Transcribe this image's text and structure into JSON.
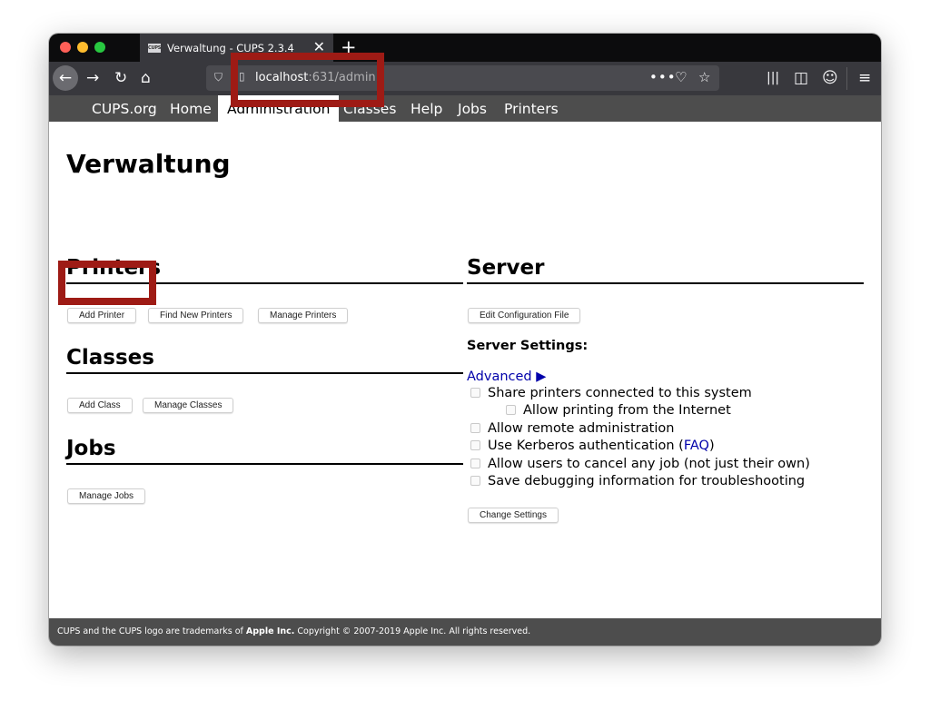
{
  "browser": {
    "tab": {
      "favicon_text": "CUPS",
      "title": "Verwaltung - CUPS 2.3.4",
      "close": "✕"
    },
    "new_tab": "+",
    "url": {
      "host": "localhost",
      "path": ":631/admin"
    },
    "icons": [
      "back-icon",
      "forward-icon",
      "reload-icon",
      "home-icon",
      "shield-icon",
      "page-icon",
      "more-icon",
      "pocket-icon",
      "bookmark-star-icon",
      "library-icon",
      "sidebar-icon",
      "account-icon",
      "menu-icon"
    ]
  },
  "menu": {
    "items": [
      {
        "label": "CUPS.org"
      },
      {
        "label": "Home"
      },
      {
        "label": "Administration",
        "active": true
      },
      {
        "label": "Classes"
      },
      {
        "label": "Help"
      },
      {
        "label": "Jobs"
      },
      {
        "label": "Printers"
      }
    ]
  },
  "page": {
    "title": "Verwaltung",
    "printers": {
      "heading": "Printers",
      "buttons": [
        "Add Printer",
        "Find New Printers",
        "Manage Printers"
      ]
    },
    "classes": {
      "heading": "Classes",
      "buttons": [
        "Add Class",
        "Manage Classes"
      ]
    },
    "jobs": {
      "heading": "Jobs",
      "buttons": [
        "Manage Jobs"
      ]
    },
    "server": {
      "heading": "Server",
      "edit_config": "Edit Configuration File",
      "settings_label": "Server Settings:",
      "advanced": "Advanced ▶",
      "options": [
        {
          "label": "Share printers connected to this system",
          "checked": false
        },
        {
          "label": "Allow printing from the Internet",
          "checked": false
        },
        {
          "label": "Allow remote administration",
          "checked": false
        },
        {
          "label": "Use Kerberos authentication (",
          "link": "FAQ",
          "suffix": ")",
          "checked": false
        },
        {
          "label": "Allow users to cancel any job (not just their own)",
          "checked": false
        },
        {
          "label": "Save debugging information for troubleshooting",
          "checked": false
        }
      ],
      "change_settings": "Change Settings"
    }
  },
  "footer": {
    "prefix": "CUPS and the CUPS logo are trademarks of ",
    "company": "Apple Inc.",
    "suffix": " Copyright © 2007-2019 Apple Inc. All rights reserved."
  },
  "colors": {
    "annotation": "#9e1b15",
    "header_bg": "#4d4d4d",
    "link": "#0000aa"
  }
}
